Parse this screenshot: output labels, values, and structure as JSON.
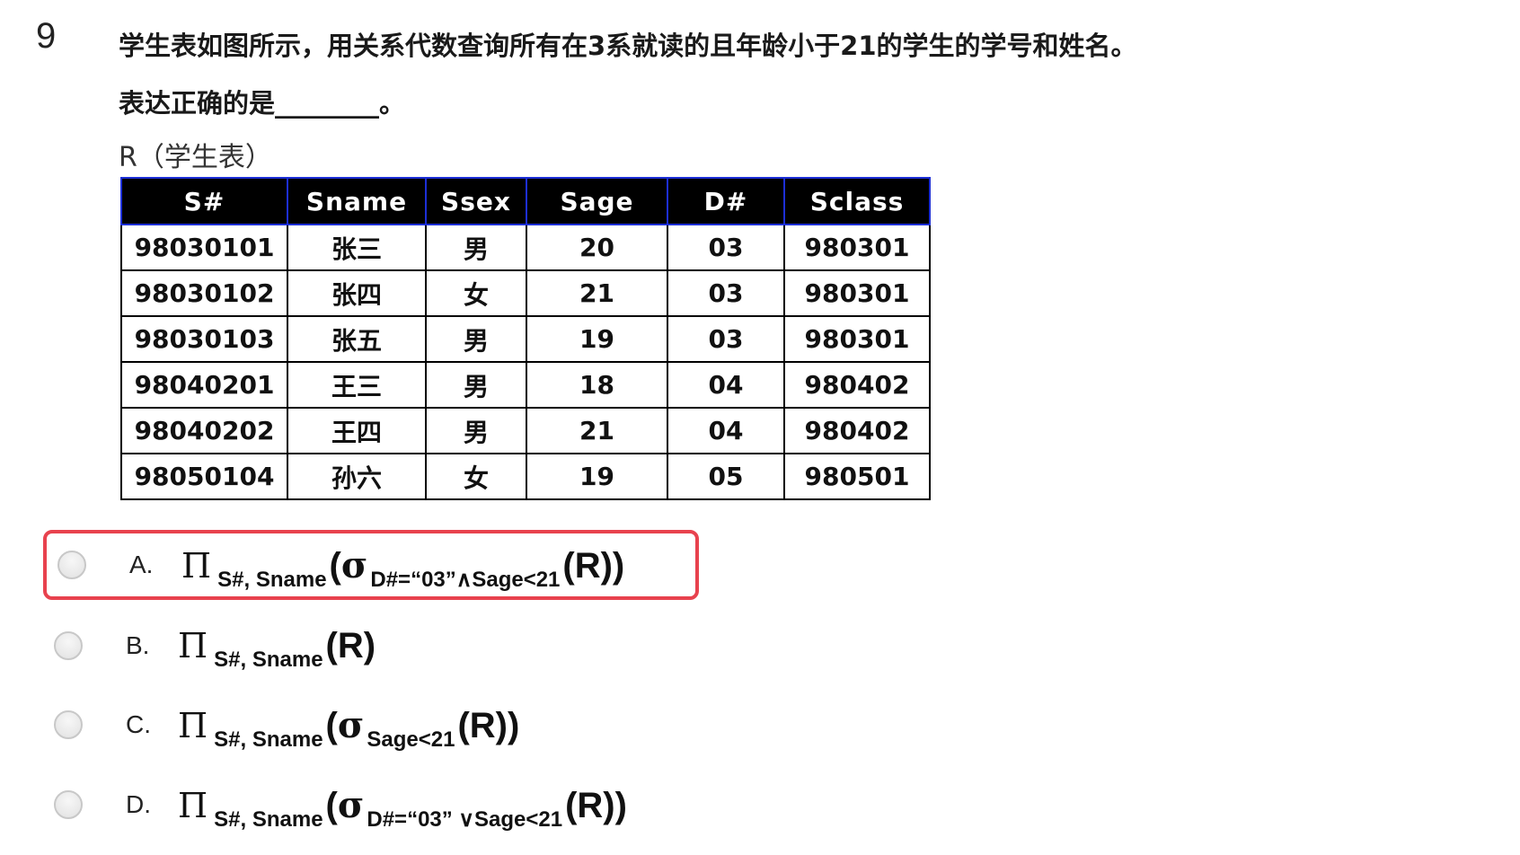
{
  "question": {
    "number": "9",
    "line1": "学生表如图所示，用关系代数查询所有在3系就读的且年龄小于21的学生的学号和姓名。",
    "line2": "表达正确的是________。",
    "table_caption": "R（学生表）"
  },
  "table": {
    "headers": [
      "S#",
      "Sname",
      "Ssex",
      "Sage",
      "D#",
      "Sclass"
    ],
    "rows": [
      [
        "98030101",
        "张三",
        "男",
        "20",
        "03",
        "980301"
      ],
      [
        "98030102",
        "张四",
        "女",
        "21",
        "03",
        "980301"
      ],
      [
        "98030103",
        "张五",
        "男",
        "19",
        "03",
        "980301"
      ],
      [
        "98040201",
        "王三",
        "男",
        "18",
        "04",
        "980402"
      ],
      [
        "98040202",
        "王四",
        "男",
        "21",
        "04",
        "980402"
      ],
      [
        "98050104",
        "孙六",
        "女",
        "19",
        "05",
        "980501"
      ]
    ]
  },
  "options": [
    {
      "letter": "A.",
      "pi": "Π",
      "proj": "S#, Sname",
      "open": "(",
      "sigma": "σ",
      "cond": "D#=“03”∧Sage<21",
      "arg": "(R))",
      "selected": true
    },
    {
      "letter": "B.",
      "pi": "Π",
      "proj": "S#, Sname",
      "open": "",
      "sigma": "",
      "cond": "",
      "arg": "(R)",
      "selected": false
    },
    {
      "letter": "C.",
      "pi": "Π",
      "proj": "S#, Sname",
      "open": "(",
      "sigma": "σ",
      "cond": "Sage<21",
      "arg": "(R))",
      "selected": false
    },
    {
      "letter": "D.",
      "pi": "Π",
      "proj": "S#, Sname",
      "open": "(",
      "sigma": "σ",
      "cond": "D#=“03” ∨Sage<21",
      "arg": "(R))",
      "selected": false
    }
  ],
  "colors": {
    "selection_border": "#e8424e",
    "header_background": "#000000",
    "header_border": "#1d2fd6"
  }
}
